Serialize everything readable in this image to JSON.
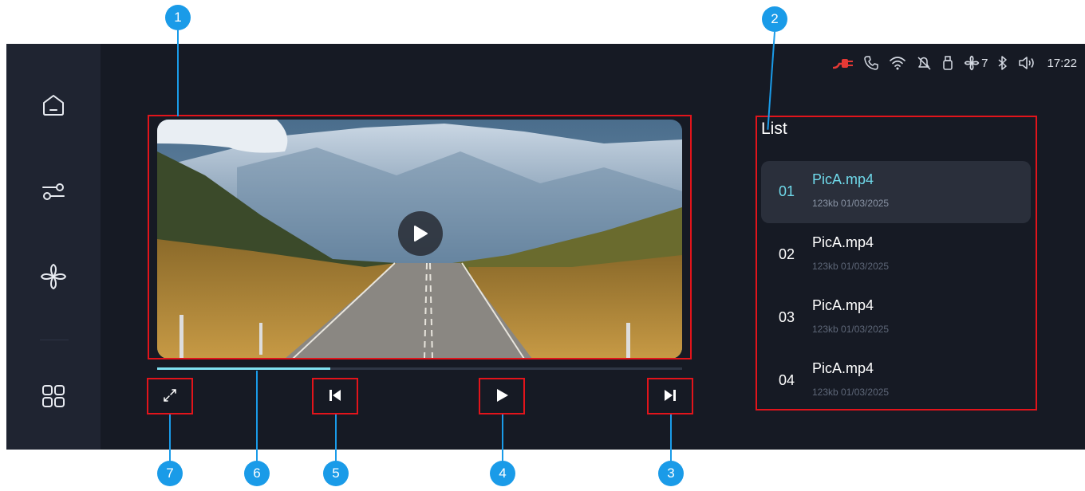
{
  "status_bar": {
    "fan_level": "7",
    "time": "17:22",
    "icons": [
      "charging-plug-icon",
      "phone-icon",
      "wifi-icon",
      "bell-off-icon",
      "usb-icon",
      "fan-icon",
      "bluetooth-icon",
      "volume-icon"
    ]
  },
  "sidebar": {
    "items": [
      {
        "name": "home",
        "icon": "home-icon"
      },
      {
        "name": "settings",
        "icon": "sliders-icon"
      },
      {
        "name": "climate",
        "icon": "fan-icon"
      },
      {
        "name": "apps",
        "icon": "grid-icon"
      }
    ]
  },
  "player": {
    "progress": 0.33,
    "controls": [
      "fullscreen",
      "previous",
      "play",
      "next"
    ]
  },
  "list": {
    "title": "List",
    "items": [
      {
        "num": "01",
        "name": "PicA.mp4",
        "meta": "123kb   01/03/2025",
        "active": true
      },
      {
        "num": "02",
        "name": "PicA.mp4",
        "meta": "123kb   01/03/2025",
        "active": false
      },
      {
        "num": "03",
        "name": "PicA.mp4",
        "meta": "123kb   01/03/2025",
        "active": false
      },
      {
        "num": "04",
        "name": "PicA.mp4",
        "meta": "123kb   01/03/2025",
        "active": false
      }
    ]
  },
  "callouts": [
    "1",
    "2",
    "3",
    "4",
    "5",
    "6",
    "7"
  ],
  "colors": {
    "accent": "#6fd9ea",
    "highlight_box": "#e2141b",
    "callout": "#1a9be8",
    "charging": "#e53935",
    "background": "#161a24",
    "sidebar": "#1f2431"
  }
}
